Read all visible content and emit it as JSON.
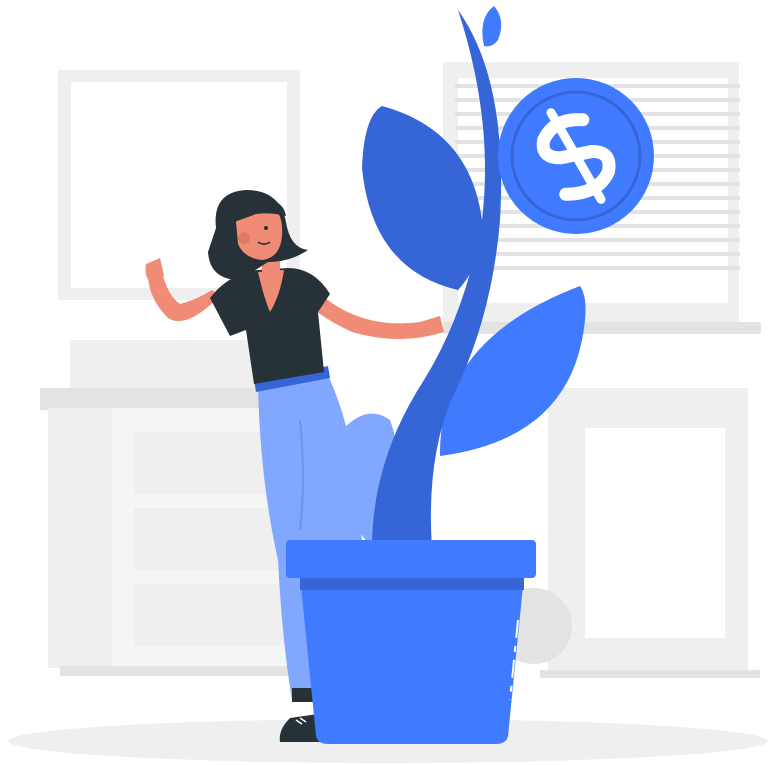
{
  "illustration": {
    "subject": "woman-with-money-plant",
    "coin_symbol": "$"
  },
  "colors": {
    "primary_blue": "#407BFF",
    "dark_blue": "#3565D6",
    "light_blue": "#82A7FF",
    "background_gray": "#EFEFEF",
    "mid_gray": "#E3E3E3",
    "dark_clothing": "#263238",
    "skin": "#F08C76",
    "hair": "#263238",
    "white": "#FFFFFF"
  }
}
